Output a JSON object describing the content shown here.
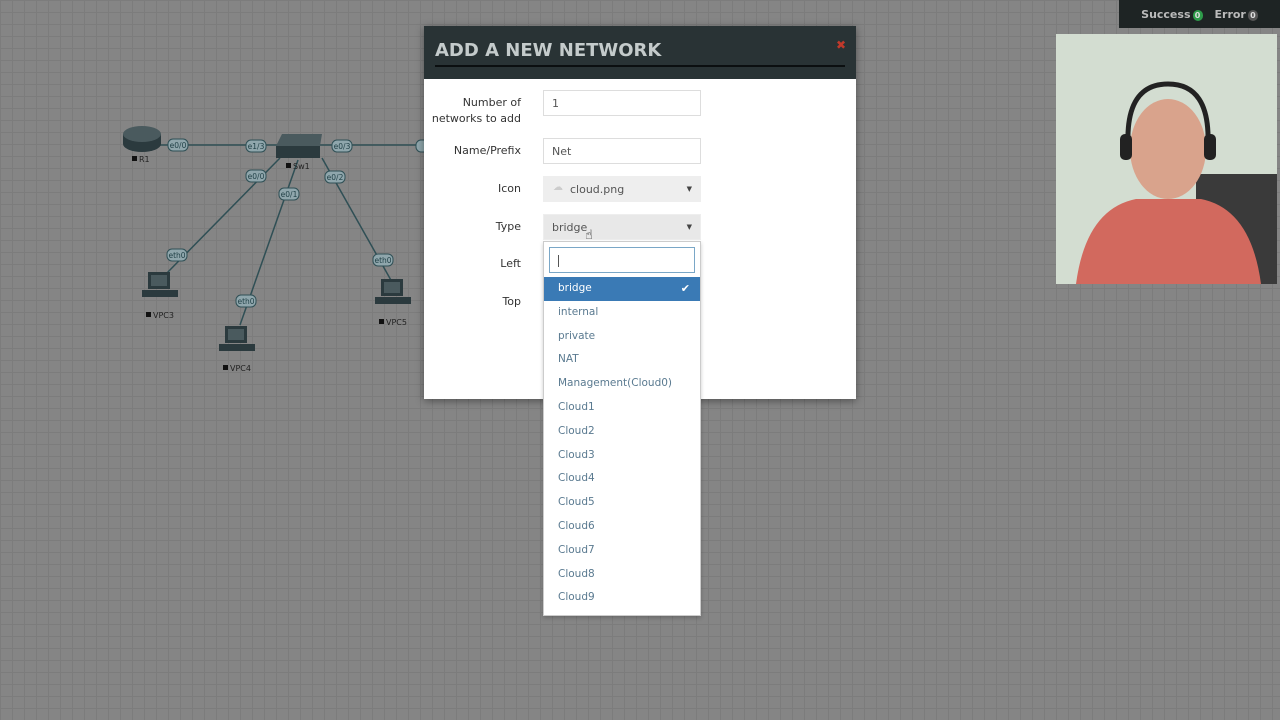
{
  "topology": {
    "nodes": [
      {
        "name": "R1",
        "type": "router"
      },
      {
        "name": "Sw1",
        "type": "switch"
      },
      {
        "name": "VPC3",
        "type": "pc"
      },
      {
        "name": "VPC4",
        "type": "pc"
      },
      {
        "name": "VPC5",
        "type": "pc"
      }
    ],
    "interfaces": [
      "e0/0",
      "e1/3",
      "e0/3",
      "e0/0",
      "e0/1",
      "e0/2",
      "eth0",
      "eth0",
      "eth0",
      "e"
    ]
  },
  "notifications": {
    "success_label": "Success",
    "success_count": "0",
    "error_label": "Error",
    "error_count": "0",
    "success_color": "#2e9b4a",
    "error_color": "#555555"
  },
  "modal": {
    "title": "ADD A NEW NETWORK",
    "close_icon": "close-icon",
    "fields": {
      "count": {
        "label": "Number of networks to add",
        "value": "1"
      },
      "name": {
        "label": "Name/Prefix",
        "value": "Net"
      },
      "icon": {
        "label": "Icon",
        "value": "cloud.png"
      },
      "type": {
        "label": "Type",
        "value": "bridge"
      },
      "left": {
        "label": "Left"
      },
      "top": {
        "label": "Top"
      }
    }
  },
  "dropdown": {
    "search_value": "",
    "selected": "bridge",
    "options": [
      "bridge",
      "internal",
      "private",
      "NAT",
      "Management(Cloud0)",
      "Cloud1",
      "Cloud2",
      "Cloud3",
      "Cloud4",
      "Cloud5",
      "Cloud6",
      "Cloud7",
      "Cloud8",
      "Cloud9"
    ],
    "accent": "#3a7ab5"
  }
}
